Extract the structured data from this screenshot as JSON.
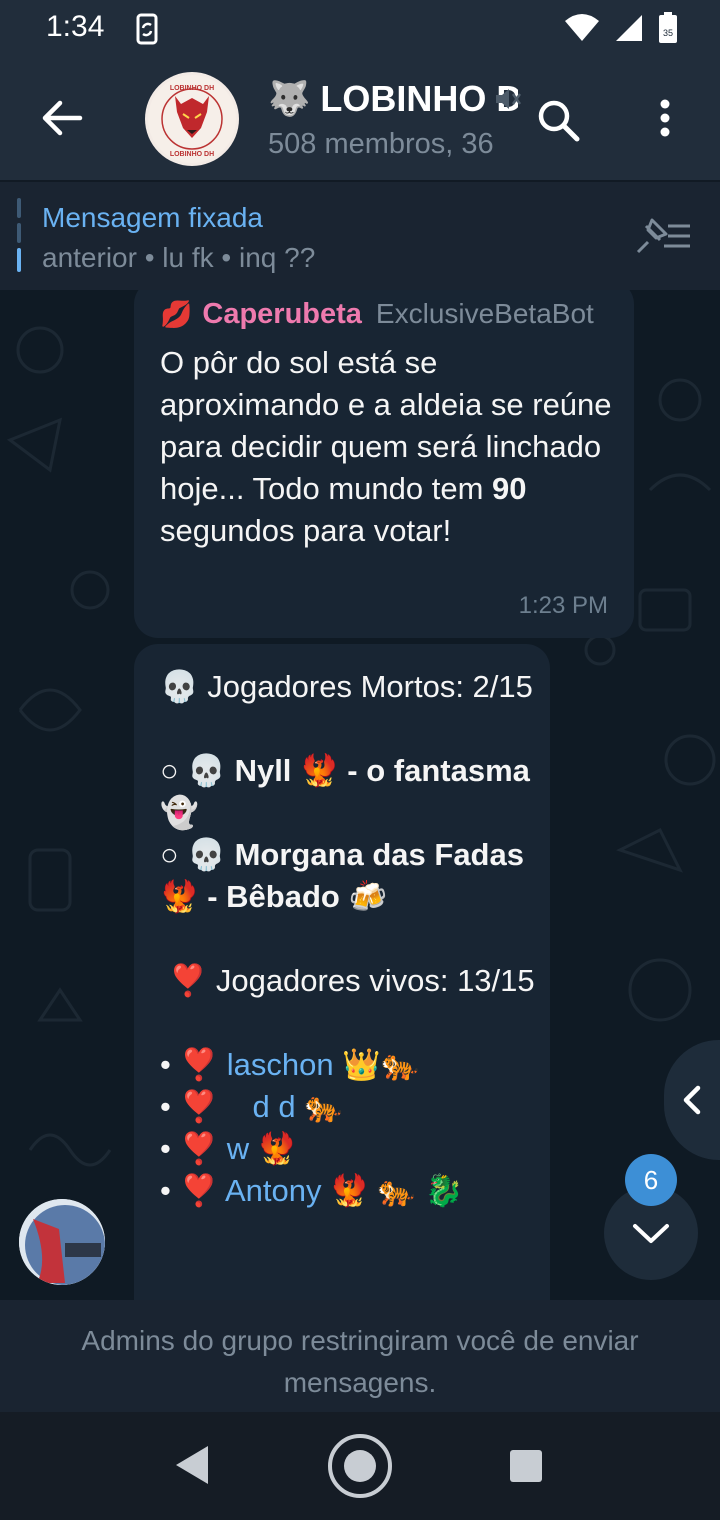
{
  "status_bar": {
    "time": "1:34",
    "battery_level": "35"
  },
  "header": {
    "title_emoji": "🐺",
    "title": "LOBINHO DH",
    "subtitle": "508 membros, 36",
    "avatar_label_top": "LOBINHO DH",
    "avatar_label_bottom": "LOBINHO DH"
  },
  "pinned": {
    "title": "Mensagem fixada",
    "text": "anterior • lu fk • inq ??"
  },
  "messages": [
    {
      "sender_emoji": "💋",
      "sender": "Caperubeta",
      "via": "ExclusiveBetaBot",
      "text_before": "O pôr do sol está se aproximando e a aldeia se reúne para decidir quem será linchado hoje... Todo mundo tem ",
      "text_bold": "90",
      "text_after": " segundos para votar!",
      "time": "1:23 PM"
    },
    {
      "dead_header": "💀 Jogadores Mortos: 2/15",
      "dead": [
        {
          "bullet": "○ 💀",
          "name": "Nyll",
          "emoji": "🐦‍🔥",
          "role": "- o fantasma 👻"
        },
        {
          "bullet": "○ 💀",
          "name": "Morgana das Fadas",
          "emoji": "🐦‍🔥",
          "role": "- Bêbado 🍻"
        }
      ],
      "alive_header": "❣️ Jogadores vivos: 13/15",
      "alive": [
        {
          "bullet": "• ❣️",
          "name": "laschon",
          "emoji": "👑🐅"
        },
        {
          "bullet": "• ❣️",
          "name": "   d d",
          "emoji": "🐅"
        },
        {
          "bullet": "• ❣️",
          "name": "w",
          "emoji": "🐦‍🔥"
        },
        {
          "bullet": "• ❣️",
          "name": "Antony",
          "emoji": "🐦‍🔥 🐅 🐉"
        }
      ]
    }
  ],
  "scroll": {
    "unread_count": "6"
  },
  "footer": {
    "restriction_text": "Admins do grupo restringiram você de enviar mensagens."
  },
  "colors": {
    "header_bg": "#212d3b",
    "chat_bg": "#0f1a24",
    "bubble_bg": "#182533",
    "link": "#6ab2f2",
    "sender": "#ee7aae",
    "badge": "#3d8fd6"
  }
}
